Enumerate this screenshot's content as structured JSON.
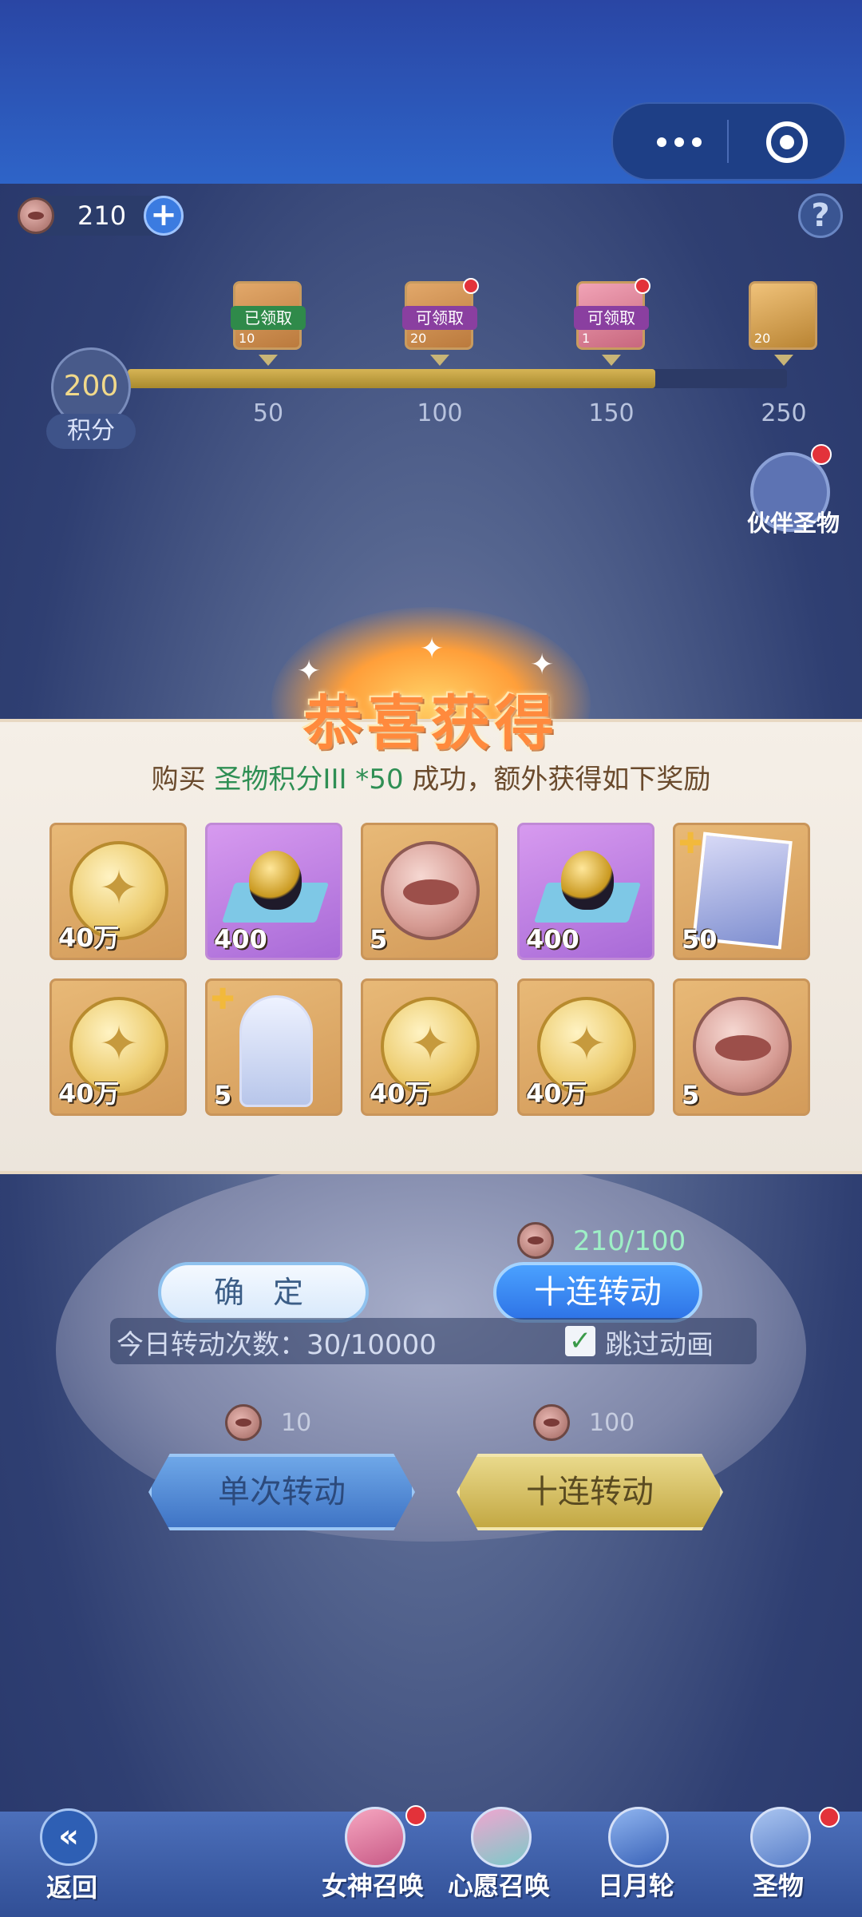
{
  "header": {
    "capsule_more_icon": "more-dots-icon",
    "capsule_target_icon": "target-icon"
  },
  "currency": {
    "amount": "210",
    "icon": "lip-token-icon",
    "add_icon": "plus-icon"
  },
  "help": {
    "label": "?"
  },
  "progress": {
    "score": "200",
    "score_label": "积分",
    "max": 250,
    "current": 200,
    "milestones": [
      {
        "value": "50",
        "tag": "已领取",
        "qty": "10",
        "tag_color": "#2f8a4a"
      },
      {
        "value": "100",
        "tag": "可领取",
        "qty": "20",
        "tag_color": "#8a3fa0"
      },
      {
        "value": "150",
        "tag": "可领取",
        "qty": "1",
        "tag_color": "#8a3fa0"
      },
      {
        "value": "250",
        "tag": "",
        "qty": "20",
        "tag_color": ""
      }
    ]
  },
  "partner_relic": {
    "label": "伙伴圣物"
  },
  "popup": {
    "title": "恭喜获得",
    "msg_prefix": "购买 ",
    "msg_item": "圣物积分III *50",
    "msg_suffix": " 成功，额外获得如下奖励",
    "rewards": [
      {
        "type": "coin",
        "qty": "40万"
      },
      {
        "type": "egg",
        "qty": "400"
      },
      {
        "type": "lip",
        "qty": "5"
      },
      {
        "type": "egg",
        "qty": "400"
      },
      {
        "type": "card",
        "qty": "50"
      },
      {
        "type": "coin",
        "qty": "40万"
      },
      {
        "type": "figure",
        "qty": "5"
      },
      {
        "type": "coin",
        "qty": "40万"
      },
      {
        "type": "coin",
        "qty": "40万"
      },
      {
        "type": "lip",
        "qty": "5"
      }
    ]
  },
  "actions": {
    "confirm": "确 定",
    "ten_spin_cost": "210/100",
    "ten_spin": "十连转动"
  },
  "daily": {
    "count_text": "今日转动次数：30/10000",
    "skip_label": "跳过动画",
    "skip_checked": true
  },
  "spin": {
    "single_cost": "10",
    "single_label": "单次转动",
    "ten_cost": "100",
    "ten_label": "十连转动"
  },
  "nav": {
    "back": "返回",
    "items": [
      "女神召唤",
      "心愿召唤",
      "日月轮",
      "圣物"
    ]
  },
  "colors": {
    "accent_blue": "#2e73e6",
    "popup_bg": "#f5efe7",
    "highlight_green": "#2f8f54",
    "progress_gold": "#d6b455"
  }
}
